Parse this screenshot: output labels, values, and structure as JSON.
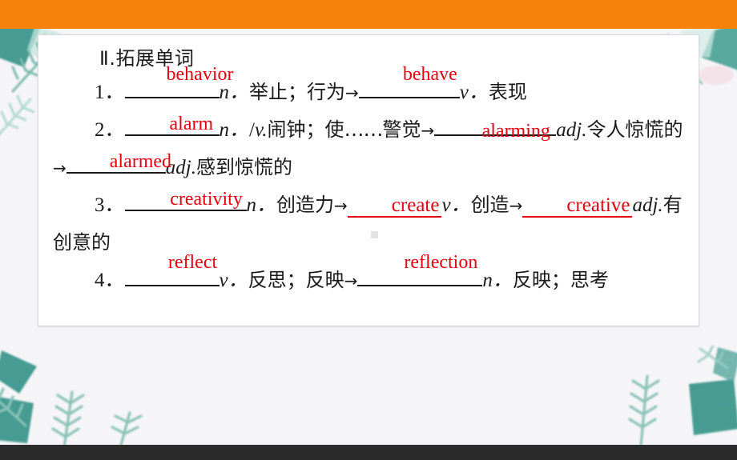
{
  "page": {
    "background_color": "#f5f5f7",
    "top_bar_color": "#f6820c",
    "bottom_bar_color": "#2b2b2b",
    "card_color": "#ffffff",
    "answer_color": "#e3000f",
    "text_color": "#1a1a1a"
  },
  "decor": {
    "leaf_color_dark": "#2f8f84",
    "leaf_color_light": "#bfe3dc",
    "top_left": "fern-leaves",
    "top_right": "fern-leaves",
    "bottom_left": "fern-leaves",
    "bottom_right": "fern-leaves"
  },
  "content": {
    "heading": "Ⅱ.拓展单词",
    "items": [
      {
        "number": "1．",
        "answer1": "behavior",
        "pos1": "n．",
        "meaning1": "举止；行为",
        "arrow1": "→",
        "answer2": "behave",
        "pos2": "v．",
        "meaning2": "表现"
      },
      {
        "number": "2．",
        "answer1": "alarm",
        "pos1": "n．",
        "sep": "/",
        "pos1b": "v.",
        "meaning1": "闹钟；使……警觉",
        "arrow1": "→",
        "answer2": "alarming",
        "pos2": "adj.",
        "meaning2": "令人惊慌的",
        "arrow2": "→",
        "answer3": "alarmed",
        "pos3": "adj.",
        "meaning3": "感到惊慌的"
      },
      {
        "number": "3．",
        "answer1": "creativity",
        "pos1": "n．",
        "meaning1": "创造力",
        "arrow1": "→",
        "answer2": "create",
        "pos2": "v．",
        "meaning2": "创造",
        "arrow2": "→",
        "answer3": "creative",
        "pos3": "adj.",
        "meaning3": "有创意的"
      },
      {
        "number": "4．",
        "answer1": "reflect",
        "pos1": "v．",
        "meaning1": "反思；反映",
        "arrow1": "→",
        "answer2": "reflection",
        "pos2": "n．",
        "meaning2": "反映；思考"
      }
    ],
    "punct": {
      "ellipsis": "……",
      "arrow": "→",
      "slash": "/"
    }
  }
}
